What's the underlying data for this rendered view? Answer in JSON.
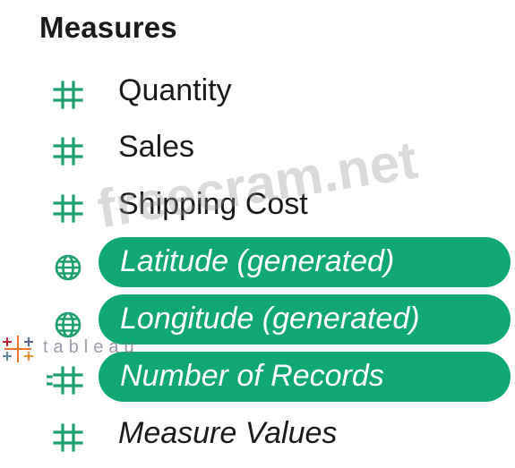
{
  "panel": {
    "title": "Measures"
  },
  "fields": [
    {
      "label": "Quantity",
      "icon": "hash-icon",
      "italic": false,
      "selected": false
    },
    {
      "label": "Sales",
      "icon": "hash-icon",
      "italic": false,
      "selected": false
    },
    {
      "label": "Shipping Cost",
      "icon": "hash-icon",
      "italic": false,
      "selected": false
    },
    {
      "label": "Latitude (generated)",
      "icon": "globe-icon",
      "italic": true,
      "selected": true
    },
    {
      "label": "Longitude (generated)",
      "icon": "globe-icon",
      "italic": true,
      "selected": true
    },
    {
      "label": "Number of Records",
      "icon": "calculated-hash-icon",
      "italic": true,
      "selected": true
    },
    {
      "label": "Measure Values",
      "icon": "hash-icon",
      "italic": true,
      "selected": false
    }
  ],
  "watermarks": {
    "site": "freecram.net",
    "brand": "tableau"
  },
  "colors": {
    "icon_green": "#1f9e6e",
    "selection_green": "#0fa774",
    "text": "#1a1a1a"
  }
}
